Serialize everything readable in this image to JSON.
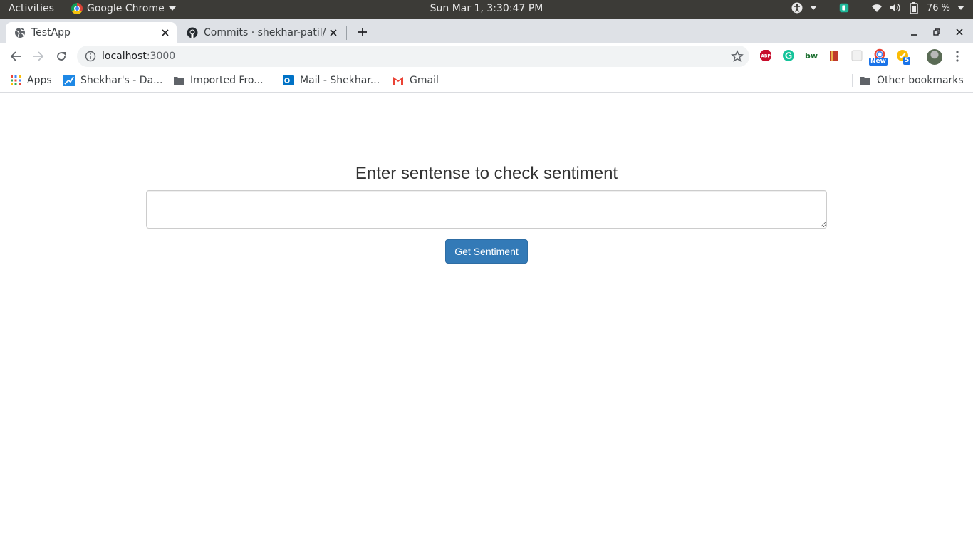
{
  "os_bar": {
    "activities": "Activities",
    "app_name": "Google Chrome",
    "clock": "Sun Mar  1,  3:30:47 PM",
    "battery": "76 %"
  },
  "tabs": [
    {
      "title": "TestApp",
      "active": true
    },
    {
      "title": "Commits · shekhar-patil/S",
      "active": false
    }
  ],
  "address_bar": {
    "host": "localhost",
    "port": ":3000"
  },
  "extensions": [
    {
      "name": "adblock-icon",
      "label": "ABP",
      "color": "#c70d2c"
    },
    {
      "name": "grammarly-icon",
      "label": "G",
      "color": "#15c39a"
    },
    {
      "name": "bw-icon",
      "label": "bw",
      "color": "#1a6e2e"
    },
    {
      "name": "book-icon",
      "label": "",
      "color": "#c0392b"
    },
    {
      "name": "puzzle-icon",
      "label": "",
      "color": "#e0e0e0"
    },
    {
      "name": "new-extension-icon",
      "label": "New",
      "color": "#1a73e8"
    },
    {
      "name": "tasks-icon",
      "label": "5",
      "color": "#1a73e8"
    }
  ],
  "bookmarks": [
    {
      "name": "apps",
      "label": "Apps"
    },
    {
      "name": "shekhars-dashboard",
      "label": "Shekhar's - Da..."
    },
    {
      "name": "imported-from",
      "label": "Imported Fro..."
    },
    {
      "name": "mail-shekhar",
      "label": "Mail - Shekhar..."
    },
    {
      "name": "gmail",
      "label": "Gmail"
    }
  ],
  "other_bookmarks": "Other bookmarks",
  "page": {
    "heading": "Enter sentense to check sentiment",
    "input_value": "",
    "button_label": "Get Sentiment"
  },
  "colors": {
    "primary_button": "#337ab7",
    "os_bar": "#3c3b37",
    "tab_strip": "#dee1e6"
  }
}
